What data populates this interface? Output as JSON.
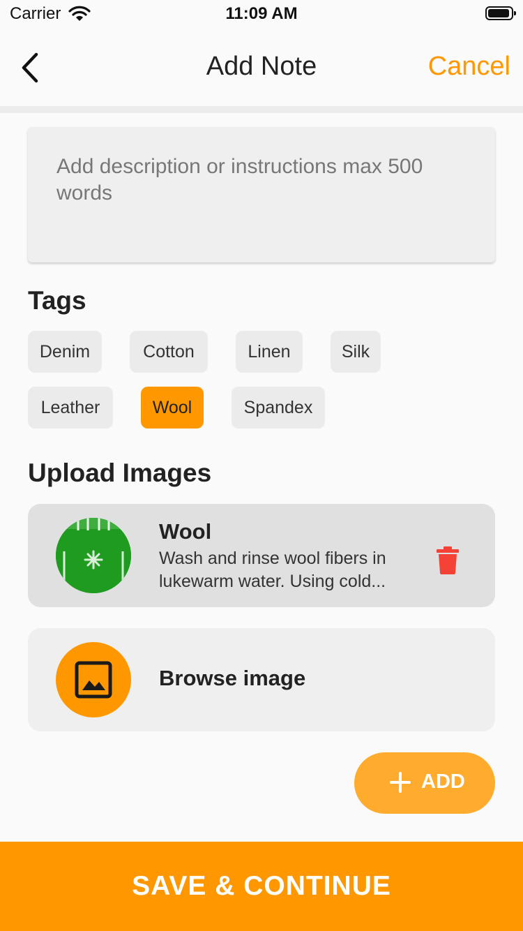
{
  "status_bar": {
    "carrier": "Carrier",
    "time": "11:09 AM"
  },
  "header": {
    "title": "Add Note",
    "cancel_label": "Cancel",
    "back_icon": "chevron-left-icon"
  },
  "description": {
    "placeholder": "Add description or instructions max 500 words"
  },
  "tags": {
    "title": "Tags",
    "items": [
      {
        "label": "Denim",
        "selected": false
      },
      {
        "label": "Cotton",
        "selected": false
      },
      {
        "label": "Linen",
        "selected": false
      },
      {
        "label": "Silk",
        "selected": false
      },
      {
        "label": "Leather",
        "selected": false
      },
      {
        "label": "Wool",
        "selected": true
      },
      {
        "label": "Spandex",
        "selected": false
      }
    ]
  },
  "upload": {
    "title": "Upload Images",
    "image": {
      "name": "Wool",
      "description": "Wash and rinse wool fibers in lukewarm water. Using cold..."
    },
    "browse_label": "Browse image"
  },
  "add_button": {
    "label": "ADD"
  },
  "save_button": {
    "label": "SAVE & CONTINUE"
  },
  "colors": {
    "accent": "#ff9800",
    "accent_light": "#ffab2e",
    "delete": "#f44336",
    "chip_bg": "#ebebeb"
  }
}
